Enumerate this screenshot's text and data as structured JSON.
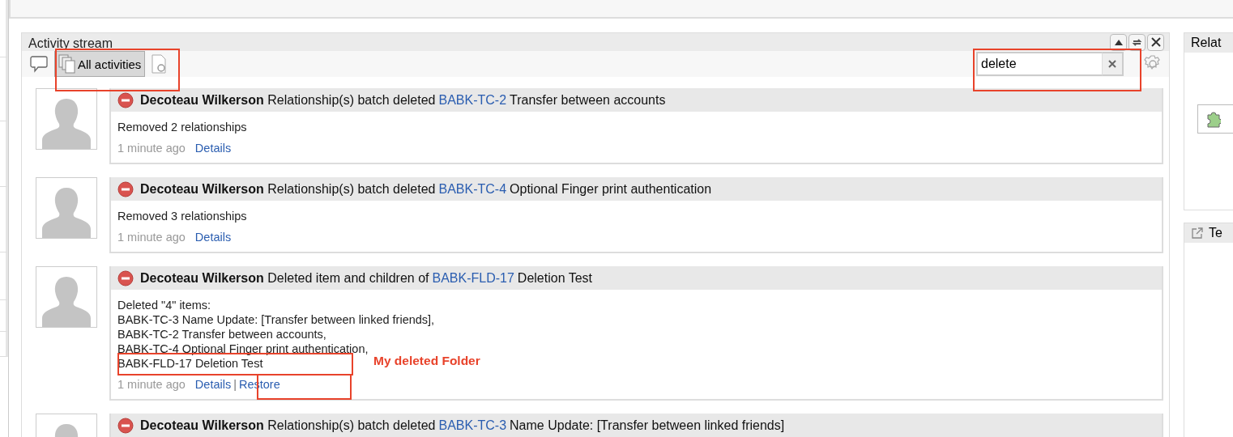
{
  "panel": {
    "title": "Activity stream",
    "filter": {
      "label": "All activities",
      "selected": true
    },
    "search": {
      "value": "delete"
    }
  },
  "activities": [
    {
      "author": "Decoteau Wilkerson",
      "action": "Relationship(s) batch deleted",
      "item_id": "BABK-TC-2",
      "item_title": "Transfer between accounts",
      "body": [
        "Removed 2 relationships"
      ],
      "time": "1 minute ago",
      "links": [
        "Details"
      ]
    },
    {
      "author": "Decoteau Wilkerson",
      "action": "Relationship(s) batch deleted",
      "item_id": "BABK-TC-4",
      "item_title": "Optional Finger print authentication",
      "body": [
        "Removed 3 relationships"
      ],
      "time": "1 minute ago",
      "links": [
        "Details"
      ]
    },
    {
      "author": "Decoteau Wilkerson",
      "action": "Deleted item and children of",
      "item_id": "BABK-FLD-17",
      "item_title": "Deletion Test",
      "body": [
        "Deleted \"4\" items:",
        "BABK-TC-3 Name Update: [Transfer between linked friends],",
        "BABK-TC-2 Transfer between accounts,",
        "BABK-TC-4 Optional Finger print authentication,",
        "BABK-FLD-17 Deletion Test"
      ],
      "time": "1 minute ago",
      "links": [
        "Details",
        "Restore"
      ],
      "separator": "|"
    },
    {
      "author": "Decoteau Wilkerson",
      "action": "Relationship(s) batch deleted",
      "item_id": "BABK-TC-3",
      "item_title": "Name Update: [Transfer between linked friends]"
    }
  ],
  "annotation": {
    "note": "My deleted Folder"
  },
  "side_panels": [
    {
      "title": "Relat"
    },
    {
      "title": "Te"
    }
  ]
}
